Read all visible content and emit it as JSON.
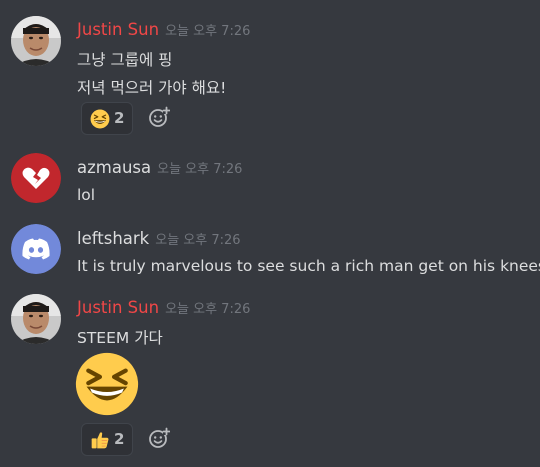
{
  "messages": [
    {
      "username": "Justin Sun",
      "username_color": "#f04747",
      "timestamp": "오늘 오후 7:26",
      "lines": [
        "그냥 그룹에 핑",
        "저녁 먹으러 가야 해요!"
      ],
      "reaction": {
        "emoji": "grinning-squinting-face",
        "count": "2"
      }
    },
    {
      "username": "azmausa",
      "username_color": "#dcddde",
      "timestamp": "오늘 오후 7:26",
      "lines": [
        "lol"
      ]
    },
    {
      "username": "leftshark",
      "username_color": "#dcddde",
      "timestamp": "오늘 오후 7:26",
      "lines": [
        "It is truly marvelous to see such a rich man get on his knees"
      ]
    },
    {
      "username": "Justin Sun",
      "username_color": "#f04747",
      "timestamp": "오늘 오후 7:26",
      "lines": [
        "STEEM 가다"
      ],
      "big_emoji": "grinning-squinting-face",
      "reaction": {
        "emoji": "thumbs-up",
        "count": "2"
      }
    }
  ],
  "colors": {
    "background": "#36393f",
    "timestamp": "#72767d",
    "reaction_bg": "#2f3136",
    "discord_blurple": "#7289da",
    "azmausa_avatar": "#c1272d",
    "emoji_yellow": "#ffcc4d"
  }
}
